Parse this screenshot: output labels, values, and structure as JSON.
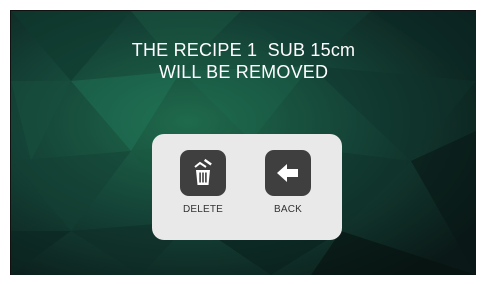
{
  "dialog": {
    "message_line1": "THE RECIPE 1  SUB 15cm",
    "message_line2": "WILL BE REMOVED"
  },
  "actions": {
    "delete": {
      "label": "DELETE",
      "icon": "delete-trash-icon"
    },
    "back": {
      "label": "BACK",
      "icon": "back-arrow-icon"
    }
  },
  "colors": {
    "background": "#0d2420",
    "panel": "#e9e9e9",
    "button_tile": "#3f3f3f",
    "text_light": "#ffffff",
    "text_dark": "#333333"
  }
}
